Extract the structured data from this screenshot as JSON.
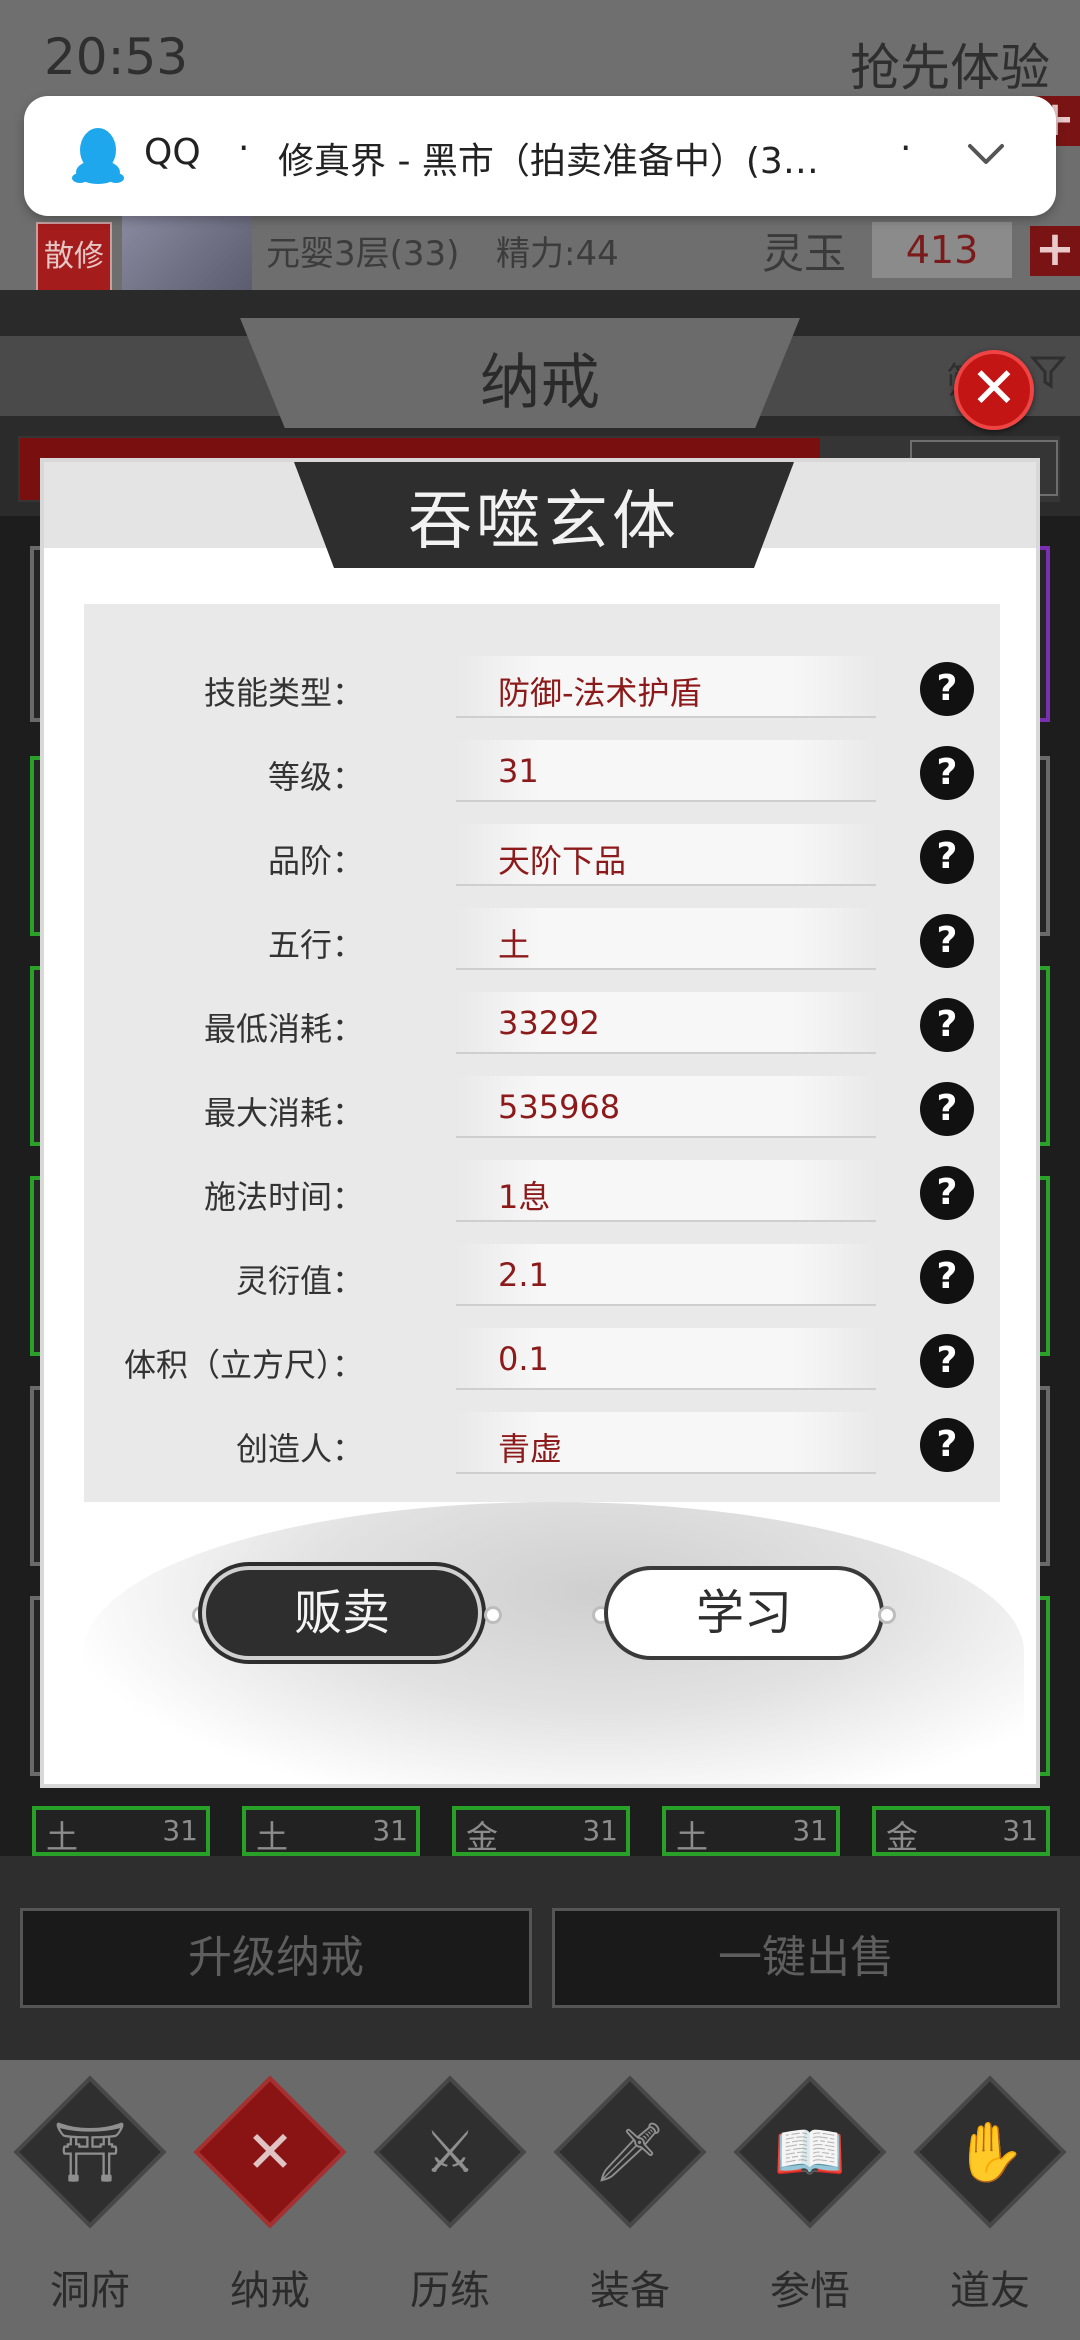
{
  "status_bar": {
    "time": "20:53",
    "right_text": "抢先体验"
  },
  "notification": {
    "app": "QQ",
    "separator": "·",
    "message": "修真界 - 黑市（拍卖准备中）(3条...",
    "trailing_dot": "·",
    "icons": [
      "qq-penguin-icon",
      "chevron-down-icon"
    ]
  },
  "player": {
    "badge": "散修",
    "realm": "元婴3层(33)",
    "energy": "精力:44",
    "currency_label": "灵玉",
    "currency_value": "413",
    "plus": "+"
  },
  "ring": {
    "title": "纳戒",
    "filter_label": "筛"
  },
  "slot_tags": [
    {
      "element": "土",
      "level": "31"
    },
    {
      "element": "土",
      "level": "31"
    },
    {
      "element": "金",
      "level": "31"
    },
    {
      "element": "土",
      "level": "31"
    },
    {
      "element": "金",
      "level": "31"
    }
  ],
  "actions": {
    "upgrade": "升级纳戒",
    "sell_all": "一键出售"
  },
  "nav": [
    {
      "label": "洞府",
      "icon": "pavilion-icon",
      "glyph": "⛩"
    },
    {
      "label": "纳戒",
      "icon": "ring-x-icon",
      "glyph": "✕"
    },
    {
      "label": "历练",
      "icon": "crossed-swords-icon",
      "glyph": "⚔"
    },
    {
      "label": "装备",
      "icon": "dagger-icon",
      "glyph": "🗡"
    },
    {
      "label": "参悟",
      "icon": "open-book-icon",
      "glyph": "📖"
    },
    {
      "label": "道友",
      "icon": "handshake-icon",
      "glyph": "✋"
    }
  ],
  "modal": {
    "title": "吞噬玄体",
    "close": "✕",
    "properties": [
      {
        "label": "技能类型：",
        "value": "防御-法术护盾"
      },
      {
        "label": "等级：",
        "value": "31"
      },
      {
        "label": "品阶：",
        "value": "天阶下品"
      },
      {
        "label": "五行：",
        "value": "土"
      },
      {
        "label": "最低消耗：",
        "value": "33292"
      },
      {
        "label": "最大消耗：",
        "value": "535968"
      },
      {
        "label": "施法时间：",
        "value": "1息"
      },
      {
        "label": "灵衍值：",
        "value": "2.1"
      },
      {
        "label": "体积（立方尺）：",
        "value": "0.1"
      },
      {
        "label": "创造人：",
        "value": "青虚"
      }
    ],
    "help_glyph": "?",
    "sell_button": "贩卖",
    "learn_button": "学习"
  }
}
